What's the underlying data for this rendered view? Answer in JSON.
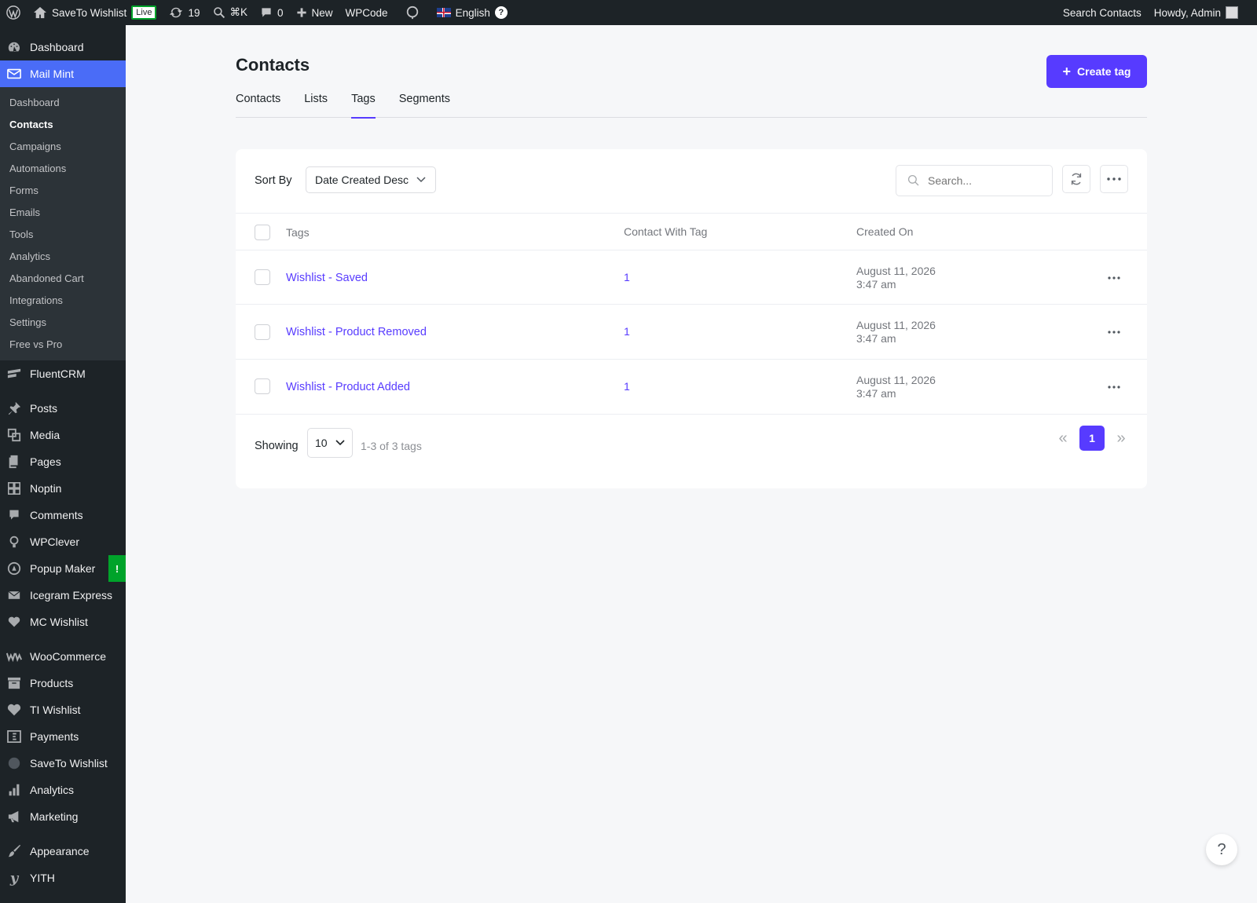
{
  "adminbar": {
    "site_name": "SaveTo Wishlist",
    "live_label": "Live",
    "updates_count": "19",
    "shortcut_label": "⌘K",
    "comments_count": "0",
    "new_label": "New",
    "wpcode_label": "WPCode",
    "language_label": "English",
    "search_contacts_label": "Search Contacts",
    "howdy_label": "Howdy, Admin"
  },
  "sidebar": {
    "dashboard": "Dashboard",
    "mailmint": "Mail Mint",
    "submenu": [
      "Dashboard",
      "Contacts",
      "Campaigns",
      "Automations",
      "Forms",
      "Emails",
      "Tools",
      "Analytics",
      "Abandoned Cart",
      "Integrations",
      "Settings",
      "Free vs Pro"
    ],
    "fluentcrm": "FluentCRM",
    "posts": "Posts",
    "media": "Media",
    "pages": "Pages",
    "noptin": "Noptin",
    "comments": "Comments",
    "wpclever": "WPClever",
    "popupmaker": "Popup Maker",
    "popupmaker_badge": "!",
    "icegram": "Icegram Express",
    "mcwishlist": "MC Wishlist",
    "woocommerce": "WooCommerce",
    "products": "Products",
    "tiwishlist": "TI Wishlist",
    "payments": "Payments",
    "savetowishlist": "SaveTo Wishlist",
    "analytics": "Analytics",
    "marketing": "Marketing",
    "appearance": "Appearance",
    "yith": "YITH"
  },
  "page": {
    "title": "Contacts",
    "create_button": "Create tag",
    "tabs": [
      "Contacts",
      "Lists",
      "Tags",
      "Segments"
    ]
  },
  "toolbar": {
    "sort_label": "Sort By",
    "sort_value": "Date Created Desc",
    "search_placeholder": "Search..."
  },
  "table": {
    "headers": {
      "tags": "Tags",
      "count": "Contact With Tag",
      "created": "Created On"
    },
    "rows": [
      {
        "name": "Wishlist - Saved",
        "count": "1",
        "date": "August 11, 2026",
        "time": "3:47 am"
      },
      {
        "name": "Wishlist - Product Removed",
        "count": "1",
        "date": "August 11, 2026",
        "time": "3:47 am"
      },
      {
        "name": "Wishlist - Product Added",
        "count": "1",
        "date": "August 11, 2026",
        "time": "3:47 am"
      }
    ]
  },
  "footer": {
    "showing_label": "Showing",
    "per_page": "10",
    "range": "1-3 of 3 tags",
    "current_page": "1"
  },
  "help_fab": "?",
  "colors": {
    "accent": "#573bff",
    "menu_active": "#4a6cf7",
    "admin_bg": "#1d2327"
  }
}
